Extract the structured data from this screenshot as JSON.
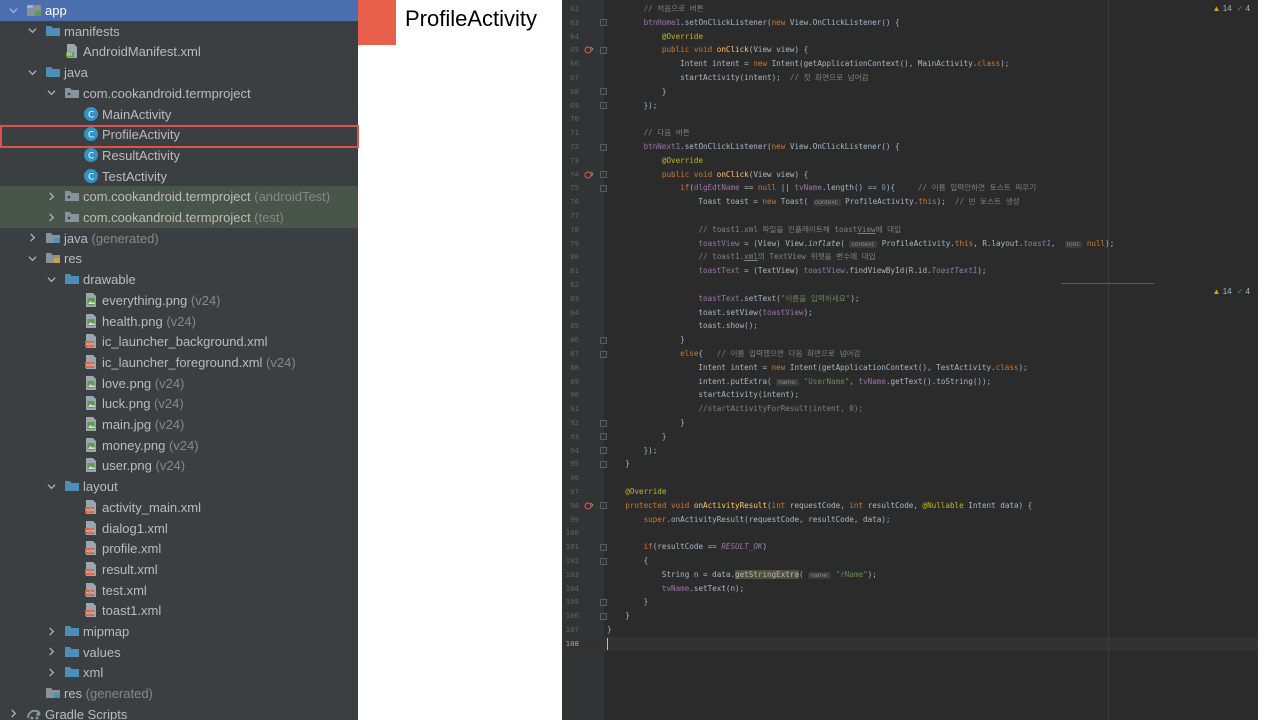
{
  "caption": {
    "title": "ProfileActivity"
  },
  "tree": {
    "rows": [
      {
        "label": "app",
        "suffix": "",
        "depth": 0,
        "arrow": "down",
        "icon": "module-icon",
        "bold": true,
        "selected": true
      },
      {
        "label": "manifests",
        "suffix": "",
        "depth": 1,
        "arrow": "down",
        "icon": "folder-icon"
      },
      {
        "label": "AndroidManifest.xml",
        "suffix": "",
        "depth": 2,
        "arrow": "",
        "icon": "manifest-file-icon"
      },
      {
        "label": "java",
        "suffix": "",
        "depth": 1,
        "arrow": "down",
        "icon": "folder-icon"
      },
      {
        "label": "com.cookandroid.termproject",
        "suffix": "",
        "depth": 2,
        "arrow": "down",
        "icon": "package-icon"
      },
      {
        "label": "MainActivity",
        "suffix": "",
        "depth": 3,
        "arrow": "",
        "icon": "class-icon"
      },
      {
        "label": "ProfileActivity",
        "suffix": "",
        "depth": 3,
        "arrow": "",
        "icon": "class-icon"
      },
      {
        "label": "ResultActivity",
        "suffix": "",
        "depth": 3,
        "arrow": "",
        "icon": "class-icon"
      },
      {
        "label": "TestActivity",
        "suffix": "",
        "depth": 3,
        "arrow": "",
        "icon": "class-icon"
      },
      {
        "label": "com.cookandroid.termproject",
        "suffix": " (androidTest)",
        "depth": 2,
        "arrow": "right",
        "icon": "package-icon",
        "test": true
      },
      {
        "label": "com.cookandroid.termproject",
        "suffix": " (test)",
        "depth": 2,
        "arrow": "right",
        "icon": "package-icon",
        "test": true
      },
      {
        "label": "java",
        "suffix": " (generated)",
        "depth": 1,
        "arrow": "right",
        "icon": "generated-folder-icon"
      },
      {
        "label": "res",
        "suffix": "",
        "depth": 1,
        "arrow": "down",
        "icon": "res-folder-icon"
      },
      {
        "label": "drawable",
        "suffix": "",
        "depth": 2,
        "arrow": "down",
        "icon": "folder-icon"
      },
      {
        "label": "everything.png",
        "suffix": " (v24)",
        "depth": 3,
        "arrow": "",
        "icon": "image-file-icon"
      },
      {
        "label": "health.png",
        "suffix": " (v24)",
        "depth": 3,
        "arrow": "",
        "icon": "image-file-icon"
      },
      {
        "label": "ic_launcher_background.xml",
        "suffix": "",
        "depth": 3,
        "arrow": "",
        "icon": "xml-file-icon"
      },
      {
        "label": "ic_launcher_foreground.xml",
        "suffix": " (v24)",
        "depth": 3,
        "arrow": "",
        "icon": "xml-file-icon"
      },
      {
        "label": "love.png",
        "suffix": " (v24)",
        "depth": 3,
        "arrow": "",
        "icon": "image-file-icon"
      },
      {
        "label": "luck.png",
        "suffix": " (v24)",
        "depth": 3,
        "arrow": "",
        "icon": "image-file-icon"
      },
      {
        "label": "main.jpg",
        "suffix": " (v24)",
        "depth": 3,
        "arrow": "",
        "icon": "image-file-icon"
      },
      {
        "label": "money.png",
        "suffix": " (v24)",
        "depth": 3,
        "arrow": "",
        "icon": "image-file-icon"
      },
      {
        "label": "user.png",
        "suffix": " (v24)",
        "depth": 3,
        "arrow": "",
        "icon": "image-file-icon"
      },
      {
        "label": "layout",
        "suffix": "",
        "depth": 2,
        "arrow": "down",
        "icon": "folder-icon"
      },
      {
        "label": "activity_main.xml",
        "suffix": "",
        "depth": 3,
        "arrow": "",
        "icon": "xml-file-icon"
      },
      {
        "label": "dialog1.xml",
        "suffix": "",
        "depth": 3,
        "arrow": "",
        "icon": "xml-file-icon"
      },
      {
        "label": "profile.xml",
        "suffix": "",
        "depth": 3,
        "arrow": "",
        "icon": "xml-file-icon"
      },
      {
        "label": "result.xml",
        "suffix": "",
        "depth": 3,
        "arrow": "",
        "icon": "xml-file-icon"
      },
      {
        "label": "test.xml",
        "suffix": "",
        "depth": 3,
        "arrow": "",
        "icon": "xml-file-icon"
      },
      {
        "label": "toast1.xml",
        "suffix": "",
        "depth": 3,
        "arrow": "",
        "icon": "xml-file-icon"
      },
      {
        "label": "mipmap",
        "suffix": "",
        "depth": 2,
        "arrow": "right",
        "icon": "folder-icon"
      },
      {
        "label": "values",
        "suffix": "",
        "depth": 2,
        "arrow": "right",
        "icon": "folder-icon"
      },
      {
        "label": "xml",
        "suffix": "",
        "depth": 2,
        "arrow": "right",
        "icon": "folder-icon"
      },
      {
        "label": "res",
        "suffix": " (generated)",
        "depth": 1,
        "arrow": "",
        "icon": "generated-folder-icon"
      },
      {
        "label": "Gradle Scripts",
        "suffix": "",
        "depth": 0,
        "arrow": "right",
        "icon": "gradle-icon"
      }
    ]
  },
  "editor": {
    "inspection_top": {
      "warnings": "14",
      "checks": "4"
    },
    "inspection_mid": {
      "warnings": "14",
      "checks": "4"
    },
    "lines": [
      {
        "n": "62",
        "html": "        <span class='c'>// 처음으로 버튼</span>"
      },
      {
        "n": "63",
        "html": "        <span class='f'>btnHome1</span>.setOnClickListener(<span class='k'>new</span> View.OnClickListener() {"
      },
      {
        "n": "64",
        "html": "            <span class='a'>@Override</span>"
      },
      {
        "n": "65",
        "html": "            <span class='k'>public void</span> <span class='m'>onClick</span>(View view) {",
        "override": true
      },
      {
        "n": "66",
        "html": "                Intent intent = <span class='k'>new</span> Intent(getApplicationContext(), MainActivity.<span class='k'>class</span>);"
      },
      {
        "n": "67",
        "html": "                startActivity(intent);  <span class='c'>// 첫 화면으로 넘어감</span>"
      },
      {
        "n": "68",
        "html": "            }"
      },
      {
        "n": "69",
        "html": "        });"
      },
      {
        "n": "70",
        "html": ""
      },
      {
        "n": "71",
        "html": "        <span class='c'>// 다음 버튼</span>"
      },
      {
        "n": "72",
        "html": "        <span class='f'>btnNext1</span>.setOnClickListener(<span class='k'>new</span> View.OnClickListener() {"
      },
      {
        "n": "73",
        "html": "            <span class='a'>@Override</span>"
      },
      {
        "n": "74",
        "html": "            <span class='k'>public void</span> <span class='m'>onClick</span>(View view) {",
        "override": true
      },
      {
        "n": "75",
        "html": "                <span class='k'>if</span>(<span class='f'>dlgEdtName</span> == <span class='k'>null</span> || <span class='f'>tvName</span>.length() == <span class='n'>0</span>){     <span class='c'>// 이름 입력안하면 토스트 띄우기</span>"
      },
      {
        "n": "76",
        "html": "                    Toast toast = <span class='k'>new</span> Toast( <span class='h'>context:</span> ProfileActivity.<span class='k'>this</span>);  <span class='c'>// 빈 토스트 생성</span>"
      },
      {
        "n": "77",
        "html": ""
      },
      {
        "n": "78",
        "html": "                    <span class='c'>// toast1.xml 파일을 인플레이트해 toast<span class='u'>View</span>에 대입</span>"
      },
      {
        "n": "79",
        "html": "                    <span class='f'>toastView</span> = (View) View.<span class='i'>inflate</span>( <span class='h'>context:</span> ProfileActivity.<span class='k'>this</span>, R.layout.<span class='fi'>toast1</span>,  <span class='h'>root:</span> <span class='k'>null</span>);"
      },
      {
        "n": "80",
        "html": "                    <span class='c'>// toast1.<span class='u'>xml</span>의 TextView 위젯을 변수에 대입</span>"
      },
      {
        "n": "81",
        "html": "                    <span class='f'>toastText</span> = (TextView) <span class='f'>toastView</span>.findViewById(R.id.<span class='fi'>ToastText1</span>);"
      },
      {
        "n": "82",
        "html": ""
      },
      {
        "n": "83",
        "html": "                    <span class='f'>toastText</span>.setText(<span class='s'>\"이름을 입력하세요\"</span>);"
      },
      {
        "n": "84",
        "html": "                    toast.setView(<span class='f'>toastView</span>);"
      },
      {
        "n": "85",
        "html": "                    toast.show();"
      },
      {
        "n": "86",
        "html": "                }"
      },
      {
        "n": "87",
        "html": "                <span class='k'>else</span>{   <span class='c'>// 이름 입력했으면 다음 화면으로 넘어감</span>"
      },
      {
        "n": "88",
        "html": "                    Intent intent = <span class='k'>new</span> Intent(getApplicationContext(), TestActivity.<span class='k'>class</span>);"
      },
      {
        "n": "89",
        "html": "                    intent.putExtra( <span class='h'>name:</span> <span class='s'>\"UserName\"</span>, <span class='f'>tvName</span>.getText().toString());"
      },
      {
        "n": "90",
        "html": "                    startActivity(intent);"
      },
      {
        "n": "91",
        "html": "                    <span class='c'>//startActivityForResult(intent, 0);</span>"
      },
      {
        "n": "92",
        "html": "                }"
      },
      {
        "n": "93",
        "html": "            }"
      },
      {
        "n": "94",
        "html": "        });"
      },
      {
        "n": "95",
        "html": "    }"
      },
      {
        "n": "96",
        "html": ""
      },
      {
        "n": "97",
        "html": "    <span class='a'>@Override</span>"
      },
      {
        "n": "98",
        "html": "    <span class='k'>protected void</span> <span class='m'>onActivityResult</span>(<span class='k'>int</span> requestCode, <span class='k'>int</span> resultCode, <span class='a'>@Nullable</span> Intent data) {",
        "override": true
      },
      {
        "n": "99",
        "html": "        <span class='k'>super</span>.onActivityResult(requestCode, resultCode, data);"
      },
      {
        "n": "100",
        "html": ""
      },
      {
        "n": "101",
        "html": "        <span class='k'>if</span>(resultCode == <span class='fi'>RESULT_OK</span>)"
      },
      {
        "n": "102",
        "html": "        {"
      },
      {
        "n": "103",
        "html": "            String n = data.<span class='hl'>getStringExtra</span>( <span class='h'>name:</span> <span class='s'>\"rName\"</span>);"
      },
      {
        "n": "104",
        "html": "            <span class='f'>tvName</span>.setText(n);"
      },
      {
        "n": "105",
        "html": "        }"
      },
      {
        "n": "106",
        "html": "    }"
      },
      {
        "n": "107",
        "html": "}"
      },
      {
        "n": "108",
        "html": "",
        "current": true
      }
    ]
  }
}
